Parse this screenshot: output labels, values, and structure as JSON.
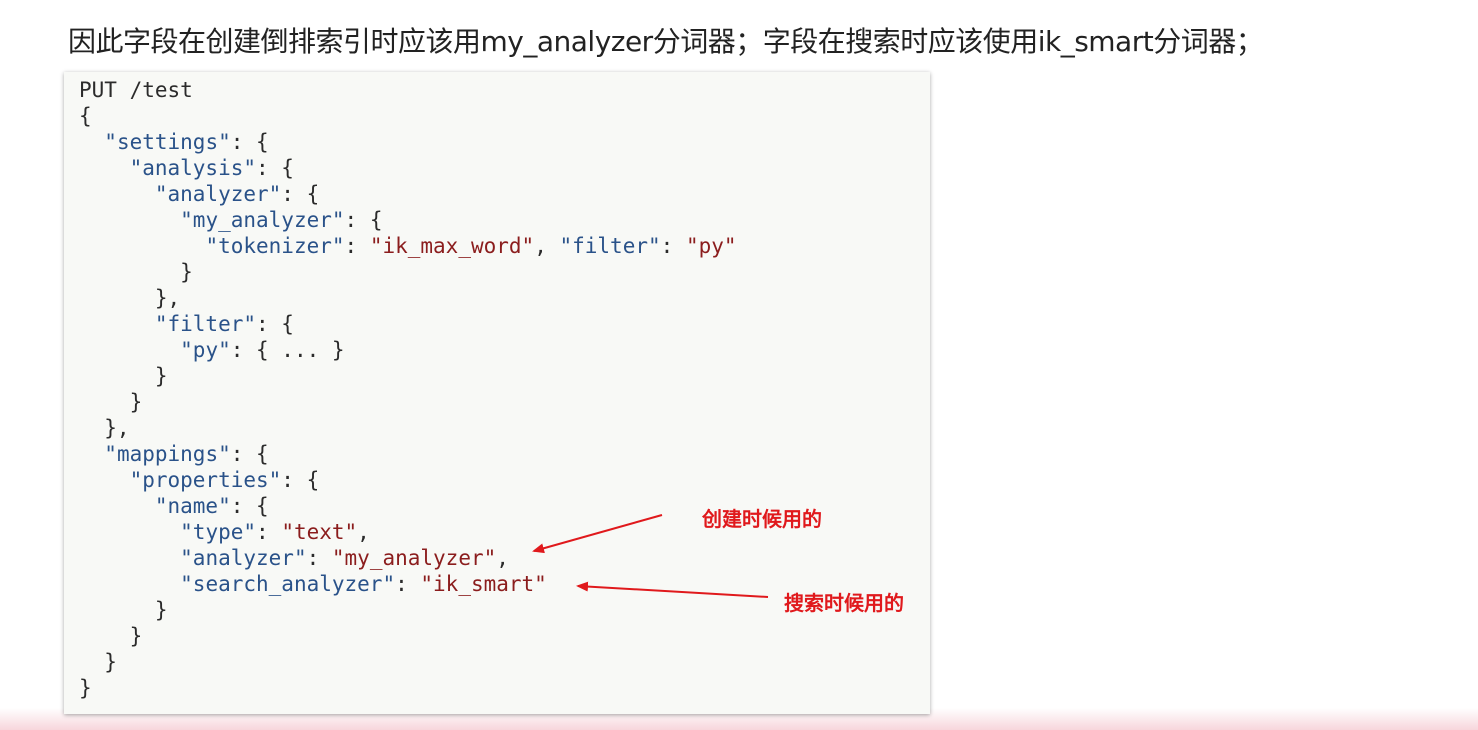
{
  "heading": "因此字段在创建倒排索引时应该用my_analyzer分词器；字段在搜索时应该使用ik_smart分词器；",
  "code": {
    "line_01": "PUT /test",
    "line_02": "{",
    "line_03": {
      "indent": "  ",
      "key": "\"settings\"",
      "rest": ": {"
    },
    "line_04": {
      "indent": "    ",
      "key": "\"analysis\"",
      "rest": ": {"
    },
    "line_05": {
      "indent": "      ",
      "key": "\"analyzer\"",
      "rest": ": {"
    },
    "line_06": {
      "indent": "        ",
      "key": "\"my_analyzer\"",
      "rest": ": {"
    },
    "line_07": {
      "indent": "          ",
      "key1": "\"tokenizer\"",
      "sep1": ": ",
      "val1": "\"ik_max_word\"",
      "sep2": ", ",
      "key2": "\"filter\"",
      "sep3": ": ",
      "val2": "\"py\""
    },
    "line_08": "        }",
    "line_09": "      },",
    "line_10": {
      "indent": "      ",
      "key": "\"filter\"",
      "rest": ": {"
    },
    "line_11": {
      "indent": "        ",
      "key": "\"py\"",
      "rest": ": { ... }"
    },
    "line_12": "      }",
    "line_13": "    }",
    "line_14": "  },",
    "line_15": {
      "indent": "  ",
      "key": "\"mappings\"",
      "rest": ": {"
    },
    "line_16": {
      "indent": "    ",
      "key": "\"properties\"",
      "rest": ": {"
    },
    "line_17": {
      "indent": "      ",
      "key": "\"name\"",
      "rest": ": {"
    },
    "line_18": {
      "indent": "        ",
      "key": "\"type\"",
      "sep": ": ",
      "val": "\"text\"",
      "tail": ","
    },
    "line_19": {
      "indent": "        ",
      "key": "\"analyzer\"",
      "sep": ": ",
      "val": "\"my_analyzer\"",
      "tail": ","
    },
    "line_20": {
      "indent": "        ",
      "key": "\"search_analyzer\"",
      "sep": ": ",
      "val": "\"ik_smart\"",
      "tail": ""
    },
    "line_21": "      }",
    "line_22": "    }",
    "line_23": "  }",
    "line_24": "}"
  },
  "annotations": {
    "create": "创建时候用的",
    "search": "搜索时候用的"
  },
  "colors": {
    "key": "#2a5289",
    "string": "#8b1d1d",
    "annotation": "#e0191c"
  }
}
